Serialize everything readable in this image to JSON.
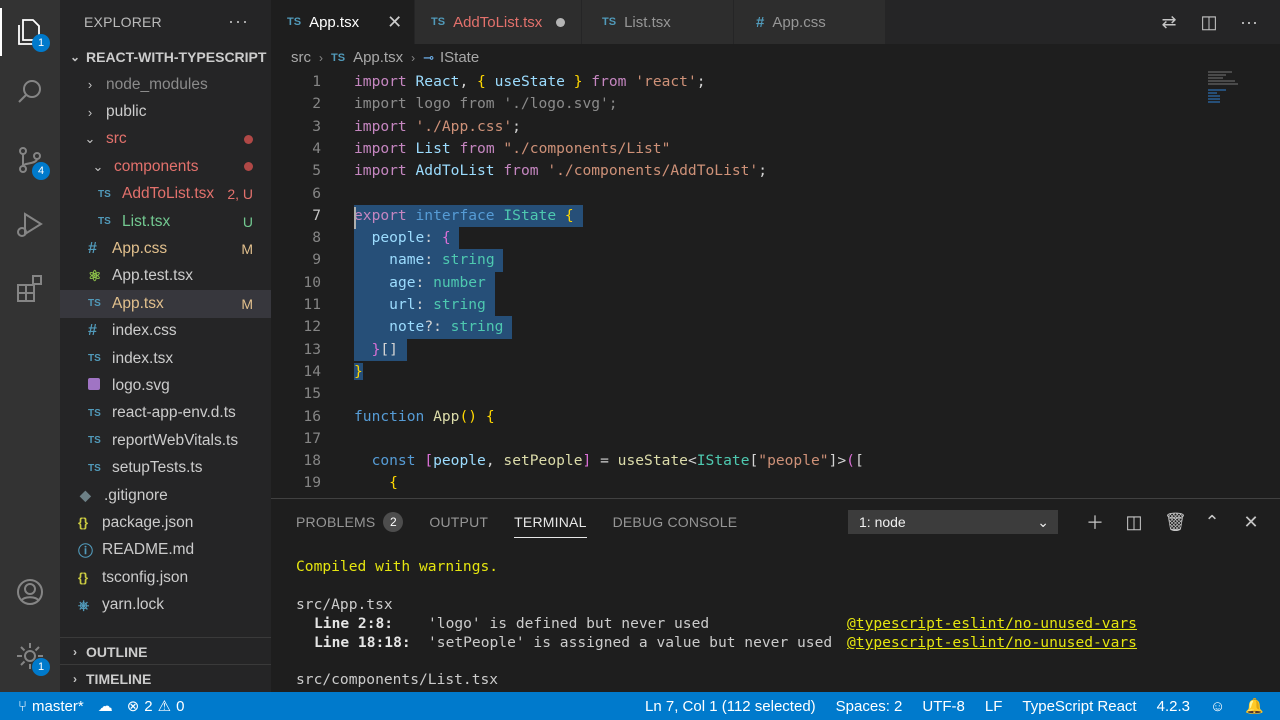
{
  "activity_bar": {
    "explorer_badge": "1",
    "scm_badge": "4",
    "settings_badge": "1"
  },
  "sidebar": {
    "title": "EXPLORER",
    "root_folder": "REACT-WITH-TYPESCRIPT",
    "items": [
      {
        "label": "node_modules",
        "type": "folder",
        "expanded": false
      },
      {
        "label": "public",
        "type": "folder",
        "expanded": false
      },
      {
        "label": "src",
        "type": "folder",
        "expanded": true
      },
      {
        "label": "components",
        "type": "folder",
        "expanded": true
      },
      {
        "label": "AddToList.tsx",
        "badge": "2, U"
      },
      {
        "label": "List.tsx",
        "badge": "U"
      },
      {
        "label": "App.css",
        "badge": "M"
      },
      {
        "label": "App.test.tsx"
      },
      {
        "label": "App.tsx",
        "badge": "M"
      },
      {
        "label": "index.css"
      },
      {
        "label": "index.tsx"
      },
      {
        "label": "logo.svg"
      },
      {
        "label": "react-app-env.d.ts"
      },
      {
        "label": "reportWebVitals.ts"
      },
      {
        "label": "setupTests.ts"
      },
      {
        "label": ".gitignore"
      },
      {
        "label": "package.json"
      },
      {
        "label": "README.md"
      },
      {
        "label": "tsconfig.json"
      },
      {
        "label": "yarn.lock"
      }
    ],
    "outline_label": "OUTLINE",
    "timeline_label": "TIMELINE"
  },
  "tabs": [
    {
      "label": "App.tsx",
      "icon": "TS",
      "active": true
    },
    {
      "label": "AddToList.tsx",
      "icon": "TS",
      "dirty": true
    },
    {
      "label": "List.tsx",
      "icon": "TS"
    },
    {
      "label": "App.css",
      "icon": "#"
    }
  ],
  "breadcrumb": {
    "folder": "src",
    "file": "App.tsx",
    "symbol": "IState"
  },
  "editor": {
    "line_numbers": [
      "1",
      "2",
      "3",
      "4",
      "5",
      "6",
      "7",
      "8",
      "9",
      "10",
      "11",
      "12",
      "13",
      "14",
      "15",
      "16",
      "17",
      "18",
      "19"
    ]
  },
  "panel": {
    "tabs": {
      "problems": "PROBLEMS",
      "problems_count": "2",
      "output": "OUTPUT",
      "terminal": "TERMINAL",
      "debug_console": "DEBUG CONSOLE"
    },
    "terminal_select": "1: node",
    "terminal_lines": {
      "compiled": "Compiled with warnings.",
      "file1": "src/App.tsx",
      "warn1_loc": "Line 2:8:",
      "warn1_msg": "'logo' is defined but never used",
      "warn1_rule": "@typescript-eslint/no-unused-vars",
      "warn2_loc": "Line 18:18:",
      "warn2_msg": "'setPeople' is assigned a value but never used",
      "warn2_rule": "@typescript-eslint/no-unused-vars",
      "file2": "src/components/List.tsx"
    }
  },
  "status_bar": {
    "branch": "master*",
    "errors": "2",
    "warnings": "0",
    "cursor": "Ln 7, Col 1 (112 selected)",
    "spaces": "Spaces: 2",
    "encoding": "UTF-8",
    "eol": "LF",
    "language": "TypeScript React",
    "version": "4.2.3"
  },
  "colors": {
    "accent": "#007acc",
    "selection": "#264f78",
    "modified": "#e2c08d",
    "untracked": "#73c991",
    "error": "#e3716c"
  }
}
